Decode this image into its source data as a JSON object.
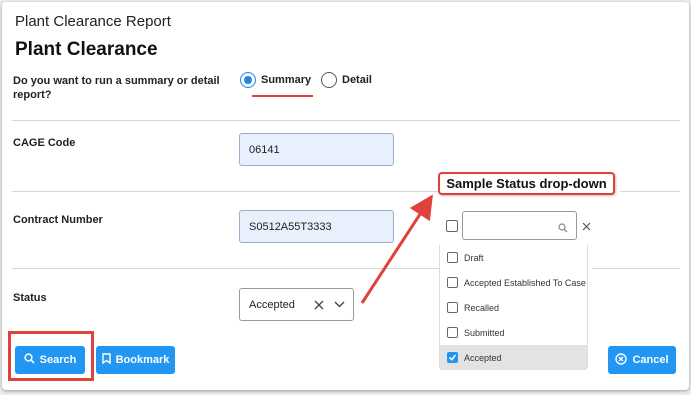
{
  "header": {
    "report_title": "Plant Clearance Report",
    "page_title": "Plant Clearance"
  },
  "report_type": {
    "question": "Do you want to run a summary or detail report?",
    "options": [
      {
        "label": "Summary",
        "selected": true
      },
      {
        "label": "Detail",
        "selected": false
      }
    ]
  },
  "cage_code": {
    "label": "CAGE Code",
    "value": "06141"
  },
  "contract_number": {
    "label": "Contract Number",
    "value": "S0512A55T3333"
  },
  "status": {
    "label": "Status",
    "value": "Accepted"
  },
  "buttons": {
    "search_label": "Search",
    "bookmark_label": "Bookmark",
    "cancel_label": "Cancel"
  },
  "annotation": {
    "callout_text": "Sample Status drop-down"
  },
  "status_dropdown": {
    "search_placeholder": "",
    "items": [
      {
        "label": "Draft",
        "checked": false
      },
      {
        "label": "Accepted Established To Case",
        "checked": false
      },
      {
        "label": "Recalled",
        "checked": false
      },
      {
        "label": "Submitted",
        "checked": false
      },
      {
        "label": "Accepted",
        "checked": true
      }
    ]
  },
  "colors": {
    "accent": "#2196f3",
    "annotation_red": "#e0413a",
    "field_fill": "#e8f0fe"
  },
  "icons": {
    "search_button_icon": "search-icon",
    "bookmark_button_icon": "bookmark-icon",
    "cancel_button_icon": "cancel-circle-icon",
    "select_clear_icon": "close-icon",
    "select_open_icon": "chevron-down-icon"
  }
}
